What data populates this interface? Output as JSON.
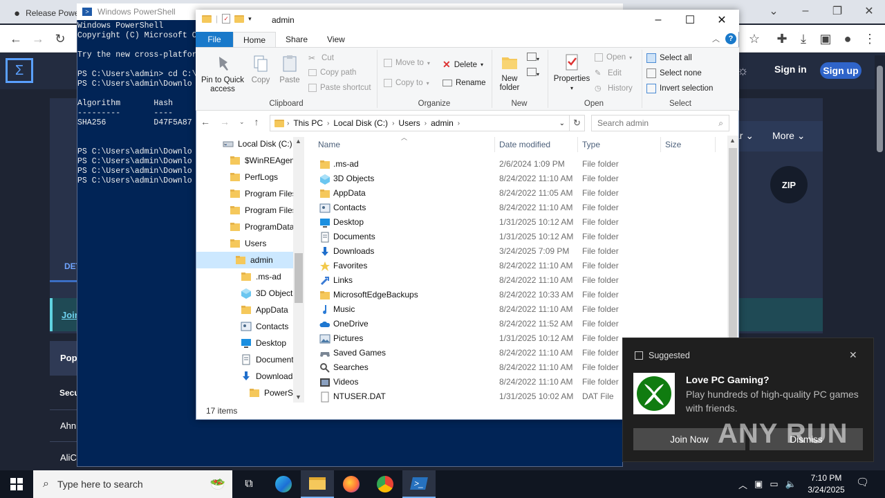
{
  "browser": {
    "tab_title": "Release Powe",
    "site": {
      "signin": "Sign in",
      "signup": "Sign up",
      "more": "More",
      "zip_badge": "ZIP",
      "details_tab": "DET",
      "join_link": "Join",
      "popular": "Pop",
      "security": "Secu",
      "row1": "Ahn",
      "row2": "AliC",
      "nav_fragment": "ar"
    }
  },
  "powershell": {
    "title": "Windows PowerShell",
    "lines": [
      "Windows PowerShell",
      "Copyright (C) Microsoft C",
      "",
      "Try the new cross-platfor",
      "",
      "PS C:\\Users\\admin> cd C:\\",
      "PS C:\\Users\\admin\\Downlo",
      "",
      "Algorithm       Hash",
      "---------       ----",
      "SHA256          D47F5A87",
      "",
      "",
      "PS C:\\Users\\admin\\Downlo",
      "PS C:\\Users\\admin\\Downlo",
      "PS C:\\Users\\admin\\Downlo",
      "PS C:\\Users\\admin\\Downlo"
    ]
  },
  "explorer": {
    "title": "admin",
    "tabs": {
      "file": "File",
      "home": "Home",
      "share": "Share",
      "view": "View"
    },
    "ribbon": {
      "pin": "Pin to Quick access",
      "copy": "Copy",
      "paste": "Paste",
      "cut": "Cut",
      "copy_path": "Copy path",
      "paste_shortcut": "Paste shortcut",
      "clipboard": "Clipboard",
      "move_to": "Move to",
      "copy_to": "Copy to",
      "delete": "Delete",
      "rename": "Rename",
      "organize": "Organize",
      "new_folder": "New folder",
      "new": "New",
      "properties": "Properties",
      "open": "Open",
      "edit": "Edit",
      "history": "History",
      "open_group": "Open",
      "select_all": "Select all",
      "select_none": "Select none",
      "invert_selection": "Invert selection",
      "select_group": "Select"
    },
    "address": {
      "crumbs": [
        "This PC",
        "Local Disk (C:)",
        "Users",
        "admin"
      ],
      "search_placeholder": "Search admin"
    },
    "nav": [
      {
        "label": "Local Disk (C:)",
        "icon": "drive-icon"
      },
      {
        "label": "$WinREAgent",
        "icon": "folder-icon"
      },
      {
        "label": "PerfLogs",
        "icon": "folder-icon"
      },
      {
        "label": "Program Files",
        "icon": "folder-icon"
      },
      {
        "label": "Program Files",
        "icon": "folder-icon"
      },
      {
        "label": "ProgramData",
        "icon": "folder-icon"
      },
      {
        "label": "Users",
        "icon": "folder-icon"
      },
      {
        "label": "admin",
        "icon": "folder-icon"
      },
      {
        "label": ".ms-ad",
        "icon": "folder-icon"
      },
      {
        "label": "3D Objects",
        "icon": "3d-objects-icon"
      },
      {
        "label": "AppData",
        "icon": "folder-icon"
      },
      {
        "label": "Contacts",
        "icon": "contacts-icon"
      },
      {
        "label": "Desktop",
        "icon": "desktop-icon"
      },
      {
        "label": "Documents",
        "icon": "documents-icon"
      },
      {
        "label": "Downloads",
        "icon": "downloads-icon"
      },
      {
        "label": "PowerSp",
        "icon": "folder-icon"
      }
    ],
    "columns": {
      "name": "Name",
      "date": "Date modified",
      "type": "Type",
      "size": "Size"
    },
    "files": [
      {
        "name": ".ms-ad",
        "date": "2/6/2024 1:09 PM",
        "type": "File folder",
        "icon": "folder-icon"
      },
      {
        "name": "3D Objects",
        "date": "8/24/2022 11:10 AM",
        "type": "File folder",
        "icon": "3d-objects-icon"
      },
      {
        "name": "AppData",
        "date": "8/24/2022 11:05 AM",
        "type": "File folder",
        "icon": "folder-icon"
      },
      {
        "name": "Contacts",
        "date": "8/24/2022 11:10 AM",
        "type": "File folder",
        "icon": "contacts-icon"
      },
      {
        "name": "Desktop",
        "date": "1/31/2025 10:12 AM",
        "type": "File folder",
        "icon": "desktop-icon"
      },
      {
        "name": "Documents",
        "date": "1/31/2025 10:12 AM",
        "type": "File folder",
        "icon": "documents-icon"
      },
      {
        "name": "Downloads",
        "date": "3/24/2025 7:09 PM",
        "type": "File folder",
        "icon": "downloads-icon"
      },
      {
        "name": "Favorites",
        "date": "8/24/2022 11:10 AM",
        "type": "File folder",
        "icon": "star-icon"
      },
      {
        "name": "Links",
        "date": "8/24/2022 11:10 AM",
        "type": "File folder",
        "icon": "links-icon"
      },
      {
        "name": "MicrosoftEdgeBackups",
        "date": "8/24/2022 10:33 AM",
        "type": "File folder",
        "icon": "folder-icon"
      },
      {
        "name": "Music",
        "date": "8/24/2022 11:10 AM",
        "type": "File folder",
        "icon": "music-icon"
      },
      {
        "name": "OneDrive",
        "date": "8/24/2022 11:52 AM",
        "type": "File folder",
        "icon": "onedrive-icon"
      },
      {
        "name": "Pictures",
        "date": "1/31/2025 10:12 AM",
        "type": "File folder",
        "icon": "pictures-icon"
      },
      {
        "name": "Saved Games",
        "date": "8/24/2022 11:10 AM",
        "type": "File folder",
        "icon": "saved-games-icon"
      },
      {
        "name": "Searches",
        "date": "8/24/2022 11:10 AM",
        "type": "File folder",
        "icon": "search-icon"
      },
      {
        "name": "Videos",
        "date": "8/24/2022 11:10 AM",
        "type": "File folder",
        "icon": "videos-icon"
      },
      {
        "name": "NTUSER.DAT",
        "date": "1/31/2025 10:02 AM",
        "type": "DAT File",
        "icon": "file-icon"
      }
    ],
    "status": "17 items"
  },
  "notification": {
    "header": "Suggested",
    "title": "Love PC Gaming?",
    "body": "Play hundreds of high-quality PC games with friends.",
    "join": "Join Now",
    "dismiss": "Dismiss",
    "watermark": "ANY RUN"
  },
  "taskbar": {
    "search_placeholder": "Type here to search",
    "time": "7:10 PM",
    "date": "3/24/2025"
  },
  "colors": {
    "accent": "#1979ca",
    "ps_bg": "#012456",
    "site_bg": "#1e2433",
    "selection": "#cce8ff"
  }
}
